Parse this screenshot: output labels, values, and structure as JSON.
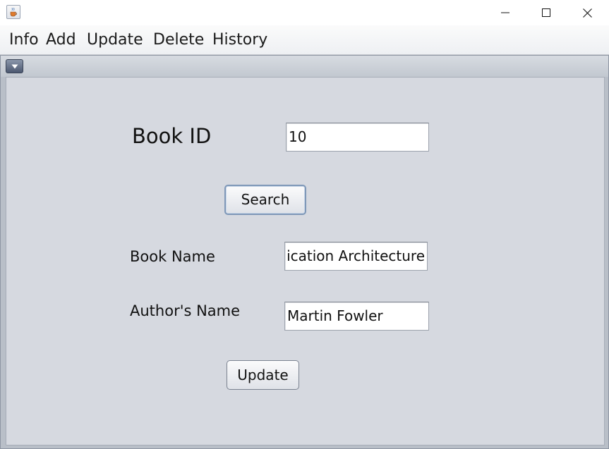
{
  "menubar": {
    "items": [
      "Info",
      "Add",
      "Update",
      "Delete",
      "History"
    ]
  },
  "form": {
    "book_id_label": "Book ID",
    "book_id_value": "10",
    "search_label": "Search",
    "book_name_label": "Book Name",
    "book_name_value": "ication Architecture",
    "author_label": "Author's Name",
    "author_value": "Martin Fowler",
    "update_label": "Update"
  },
  "icons": {
    "app": "java-cup-icon",
    "minimize": "minimize-icon",
    "maximize": "maximize-icon",
    "close": "close-icon",
    "frame_menu": "chevron-down-icon"
  },
  "colors": {
    "content_background": "#d6d9e0",
    "frame_background": "#b9bfc8",
    "search_focus_border": "#7f98b8"
  }
}
